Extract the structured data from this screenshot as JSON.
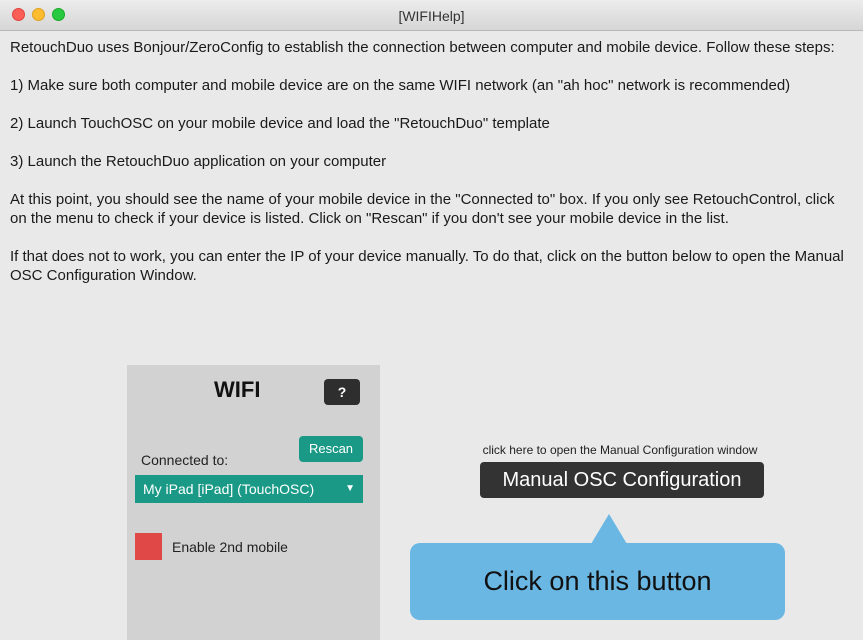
{
  "window": {
    "title": "[WIFIHelp]"
  },
  "help_text": {
    "intro": "RetouchDuo uses Bonjour/ZeroConfig to establish the connection between computer and mobile device. Follow these steps:",
    "step1": "1) Make sure both computer and mobile device are on the same WIFI network (an \"ah hoc\" network is recommended)",
    "step2": "2) Launch TouchOSC on your mobile device and load the \"RetouchDuo\" template",
    "step3": "3) Launch the RetouchDuo application on your computer",
    "connected_note": "At this point, you should see the name of your mobile device in the \"Connected to\" box. If you only see RetouchControl, click on the menu to check if your device is listed. Click on \"Rescan\" if you don't see your mobile device in the list.",
    "manual_note": "If that does not to work, you can enter the IP of your device manually. To do that, click on the button below to open the Manual OSC Configuration Window."
  },
  "wifi_panel": {
    "title": "WIFI",
    "help_label": "?",
    "rescan_label": "Rescan",
    "connected_label": "Connected to:",
    "device_selected": "My iPad [iPad] (TouchOSC)",
    "enable_2nd_label": "Enable 2nd mobile",
    "enable_2nd_color": "#e04848",
    "accent_color": "#1a9a86"
  },
  "manual_config": {
    "hint": "click here to open the Manual Configuration window",
    "button_label": "Manual OSC Configuration"
  },
  "callout": {
    "text": "Click on this button",
    "color": "#6ab7e3"
  }
}
